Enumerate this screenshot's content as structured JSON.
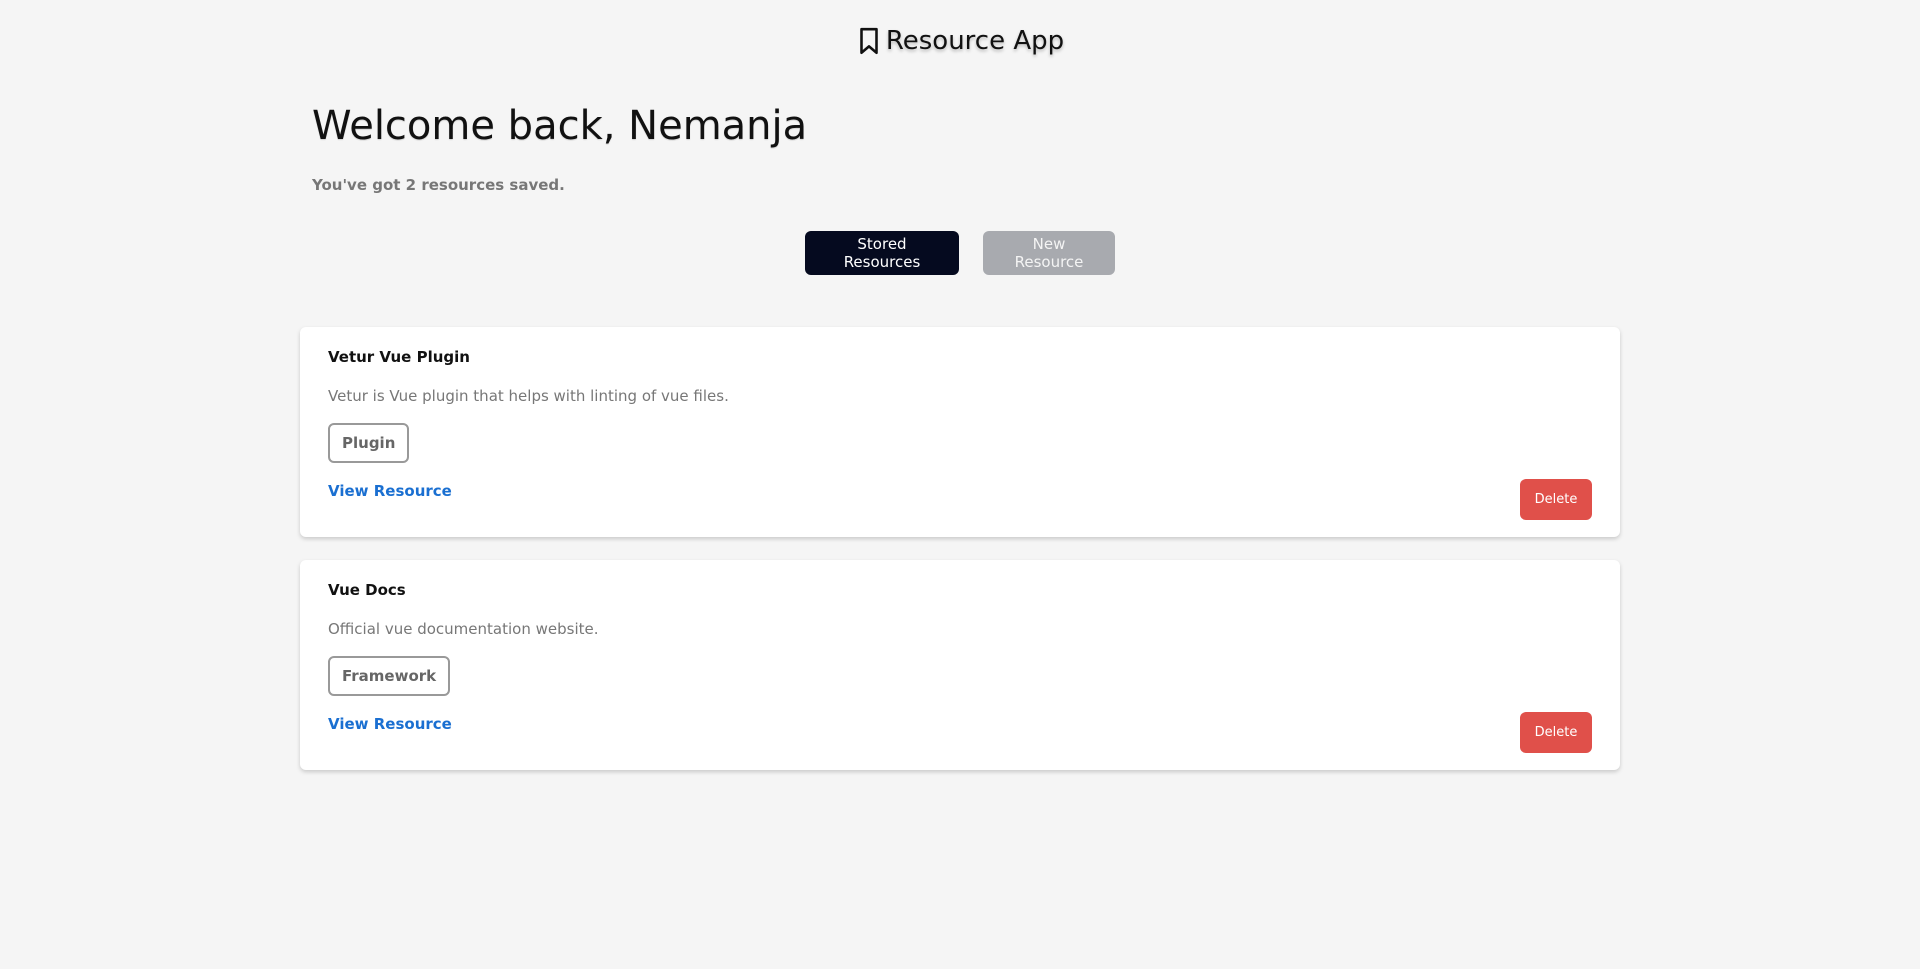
{
  "header": {
    "title": "Resource App",
    "icon": "bookmark-icon"
  },
  "welcome": {
    "heading": "Welcome back, Nemanja",
    "summary": "You've got 2 resources saved."
  },
  "tabs": {
    "stored_label": "Stored Resources",
    "new_label": "New Resource"
  },
  "resources": [
    {
      "title": "Vetur Vue Plugin",
      "description": "Vetur is Vue plugin that helps with linting of vue files.",
      "tag": "Plugin",
      "link_label": "View Resource",
      "delete_label": "Delete"
    },
    {
      "title": "Vue Docs",
      "description": "Official vue documentation website.",
      "tag": "Framework",
      "link_label": "View Resource",
      "delete_label": "Delete"
    }
  ],
  "colors": {
    "background": "#f5f5f5",
    "tab_active": "#050a1f",
    "tab_inactive": "#a8aaaf",
    "link": "#1a6fd1",
    "delete": "#e0504a"
  }
}
